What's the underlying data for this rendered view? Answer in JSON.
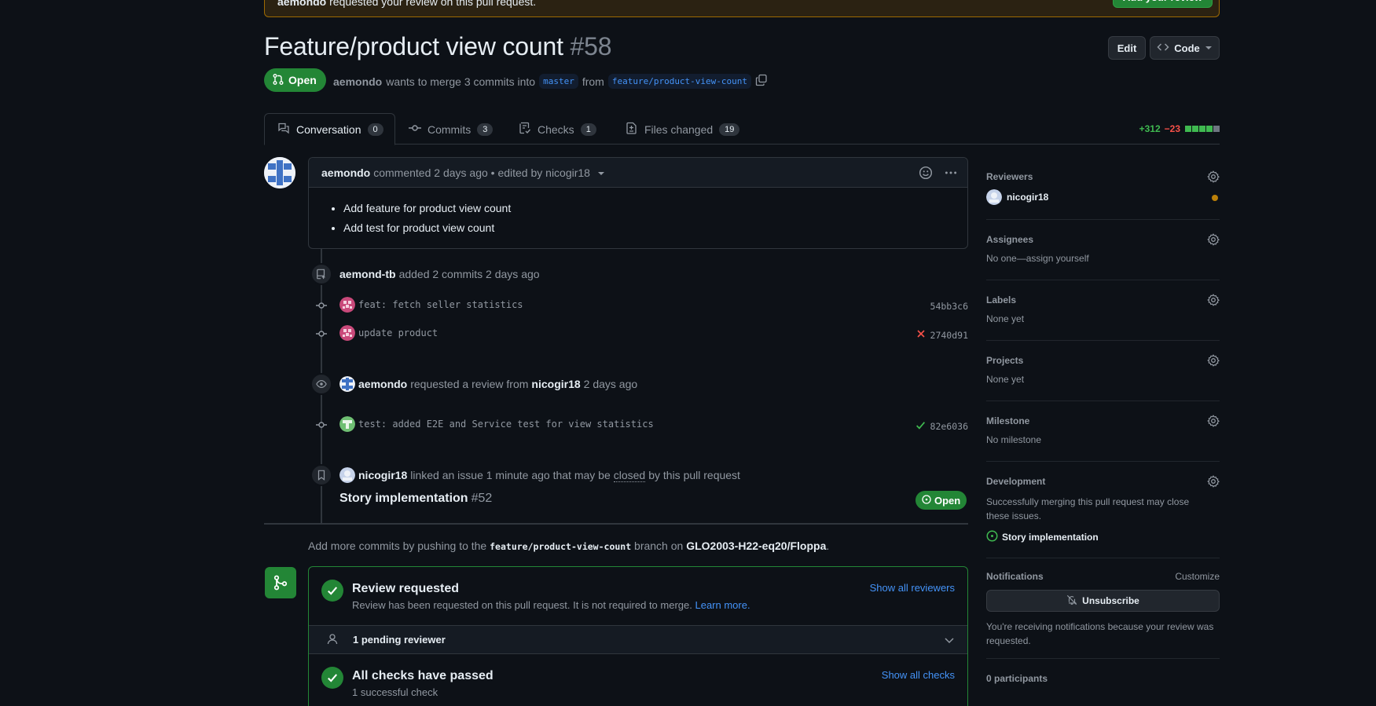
{
  "banner": {
    "author": "aemondo",
    "text": "requested your review on this pull request.",
    "button": "Add your review"
  },
  "pr": {
    "title": "Feature/product view count",
    "number": "#58",
    "state": "Open",
    "author": "aemondo",
    "merge_text": "wants to merge 3 commits into",
    "base_branch": "master",
    "from_text": "from",
    "head_branch": "feature/product-view-count"
  },
  "header_buttons": {
    "edit": "Edit",
    "code": "Code"
  },
  "tabs": [
    {
      "label": "Conversation",
      "count": "0"
    },
    {
      "label": "Commits",
      "count": "3"
    },
    {
      "label": "Checks",
      "count": "1"
    },
    {
      "label": "Files changed",
      "count": "19"
    }
  ],
  "diffstat": {
    "additions": "+312",
    "deletions": "−23",
    "colors": [
      "#3fb950",
      "#3fb950",
      "#3fb950",
      "#3fb950",
      "#6e7681"
    ]
  },
  "comment": {
    "author": "aemondo",
    "meta": "commented 2 days ago • edited by nicogir18",
    "items": [
      "Add feature for product view count",
      "Add test for product view count"
    ]
  },
  "timeline": {
    "commits_event": {
      "author": "aemond-tb",
      "text": "added 2 commits 2 days ago"
    },
    "commits": [
      {
        "message": "feat: fetch seller statistics",
        "sha": "54bb3c6",
        "status": ""
      },
      {
        "message": "update product",
        "sha": "2740d91",
        "status": "fail"
      }
    ],
    "review_event": {
      "author": "aemondo",
      "text": "requested a review from",
      "reviewer": "nicogir18",
      "time": "2 days ago"
    },
    "commit3": {
      "message": "test: added E2E and Service test for view statistics",
      "sha": "82e6036",
      "status": "success"
    },
    "link_event": {
      "author": "nicogir18",
      "text": "linked an issue 1 minute ago that may be",
      "closed": "closed",
      "tail": "by this pull request"
    },
    "issue": {
      "title": "Story implementation",
      "number": "#52",
      "state": "Open"
    }
  },
  "push_line": {
    "prefix": "Add more commits by pushing to the",
    "branch": "feature/product-view-count",
    "mid": "branch on",
    "repo": "GLO2003-H22-eq20/Floppa",
    "suffix": "."
  },
  "merge_box": {
    "review_title": "Review requested",
    "review_sub": "Review has been requested on this pull request. It is not required to merge.",
    "learn_more": "Learn more.",
    "show_reviewers": "Show all reviewers",
    "pending": "1 pending reviewer",
    "checks_title": "All checks have passed",
    "checks_sub": "1 successful check",
    "show_checks": "Show all checks"
  },
  "sidebar": {
    "reviewers": {
      "title": "Reviewers",
      "name": "nicogir18"
    },
    "assignees": {
      "title": "Assignees",
      "value": "No one—assign yourself"
    },
    "labels": {
      "title": "Labels",
      "value": "None yet"
    },
    "projects": {
      "title": "Projects",
      "value": "None yet"
    },
    "milestone": {
      "title": "Milestone",
      "value": "No milestone"
    },
    "development": {
      "title": "Development",
      "value": "Successfully merging this pull request may close these issues.",
      "issue": "Story implementation"
    },
    "notifications": {
      "title": "Notifications",
      "customize": "Customize",
      "button": "Unsubscribe",
      "note": "You're receiving notifications because your review was requested."
    },
    "participants": "0 participants"
  }
}
